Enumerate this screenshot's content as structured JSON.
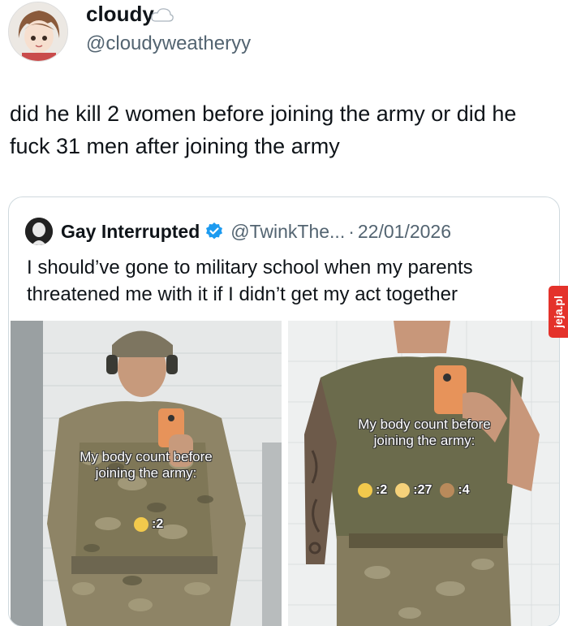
{
  "post": {
    "display_name": "cloudy",
    "handle": "@cloudyweatheryy",
    "text": "did he kill 2 women before joining the army or did he fuck 31 men after joining the army"
  },
  "quoted": {
    "display_name": "Gay Interrupted",
    "handle": "@TwinkThe...",
    "separator": "·",
    "date": "22/01/2026",
    "text": "I should’ve gone to military school when my parents threatened me with it if I didn’t get my act together"
  },
  "images": {
    "left": {
      "caption": "My body count before joining the army:",
      "counts": [
        {
          "icon": "woman-emoji",
          "value": ":2"
        }
      ]
    },
    "right": {
      "caption": "My body count before joining the army:",
      "counts": [
        {
          "icon": "woman-emoji",
          "value": ":2"
        },
        {
          "icon": "man-emoji",
          "value": ":27"
        },
        {
          "icon": "bearded-man-emoji",
          "value": ":4"
        }
      ]
    }
  },
  "watermark": "jeja.pl",
  "colors": {
    "text": "#0f1419",
    "secondary": "#536471",
    "border": "#cfd9de",
    "verified": "#1d9bf0",
    "watermark": "#e4322b"
  }
}
